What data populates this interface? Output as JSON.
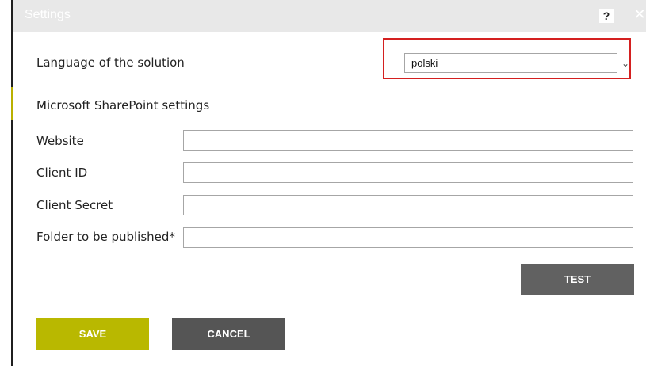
{
  "window": {
    "title": "Settings",
    "help_label": "?",
    "close_label": "✕"
  },
  "language": {
    "label": "Language of the solution",
    "selected": "polski",
    "arrow_icon": "chevron-down-icon"
  },
  "sharepoint": {
    "section_title": "Microsoft SharePoint settings",
    "fields": {
      "website": {
        "label": "Website",
        "value": ""
      },
      "client_id": {
        "label": "Client ID",
        "value": ""
      },
      "client_secret": {
        "label": "Client Secret",
        "value": ""
      },
      "folder": {
        "label": "Folder to be published*",
        "value": ""
      }
    }
  },
  "buttons": {
    "test": "TEST",
    "save": "SAVE",
    "cancel": "CANCEL"
  },
  "colors": {
    "save": "#b9b800",
    "cancel": "#555555",
    "test": "#616161",
    "highlight": "#d42020"
  }
}
